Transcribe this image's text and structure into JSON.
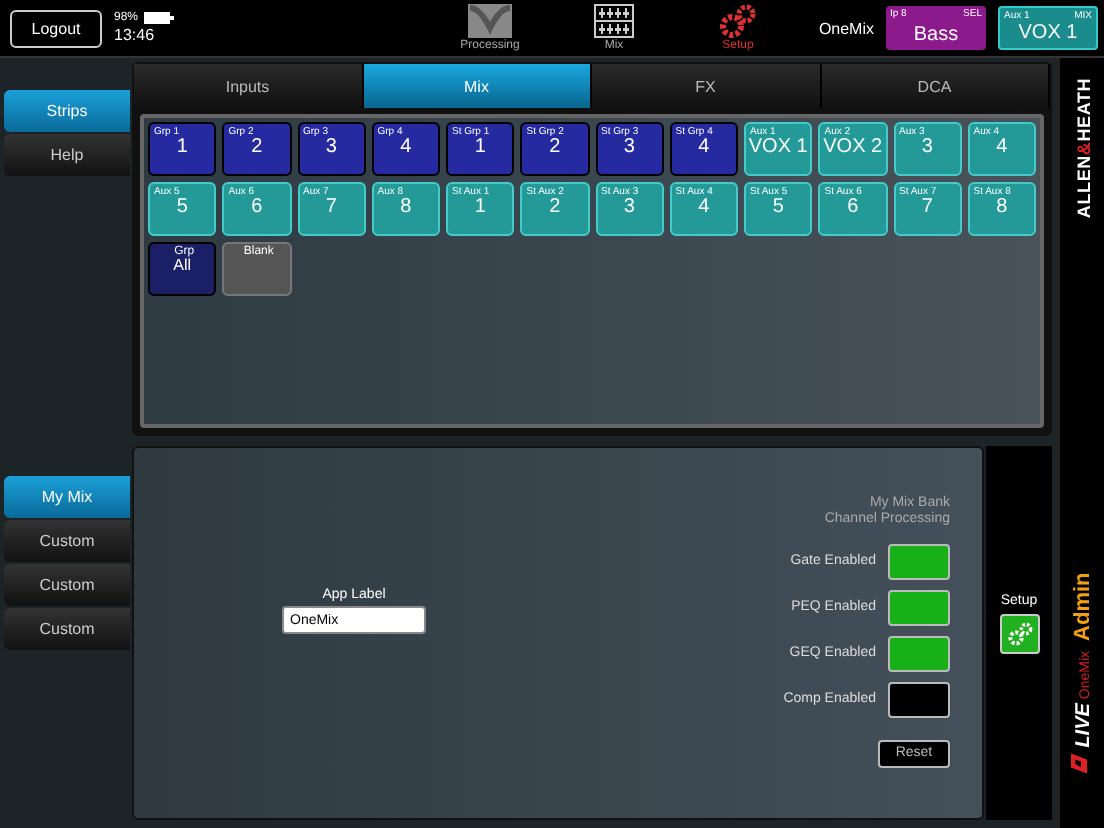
{
  "top_bar": {
    "logout": "Logout",
    "battery": "98%",
    "time": "13:46",
    "nav": [
      {
        "label": "Processing",
        "kind": "processing",
        "selected": false
      },
      {
        "label": "Mix",
        "kind": "mix",
        "selected": false
      },
      {
        "label": "Setup",
        "kind": "setup",
        "selected": true
      }
    ],
    "mix_name": "OneMix",
    "strips": [
      {
        "tag": "Ip 8",
        "mode": "SEL",
        "name": "Bass",
        "kind": "input"
      },
      {
        "tag": "Aux 1",
        "mode": "MIX",
        "name": "VOX 1",
        "kind": "aux"
      }
    ]
  },
  "left_menu": [
    {
      "label": "Strips",
      "selected": true
    },
    {
      "label": "Help",
      "selected": false
    }
  ],
  "tabs": [
    {
      "label": "Inputs",
      "selected": false
    },
    {
      "label": "Mix",
      "selected": true
    },
    {
      "label": "FX",
      "selected": false
    },
    {
      "label": "DCA",
      "selected": false
    }
  ],
  "tiles": [
    {
      "tag": "Grp 1",
      "name": "1",
      "kind": "group"
    },
    {
      "tag": "Grp 2",
      "name": "2",
      "kind": "group"
    },
    {
      "tag": "Grp 3",
      "name": "3",
      "kind": "group"
    },
    {
      "tag": "Grp 4",
      "name": "4",
      "kind": "group"
    },
    {
      "tag": "St Grp 1",
      "name": "1",
      "kind": "group"
    },
    {
      "tag": "St Grp 2",
      "name": "2",
      "kind": "group"
    },
    {
      "tag": "St Grp 3",
      "name": "3",
      "kind": "group"
    },
    {
      "tag": "St Grp 4",
      "name": "4",
      "kind": "group"
    },
    {
      "tag": "Aux 1",
      "name": "VOX 1",
      "kind": "aux"
    },
    {
      "tag": "Aux 2",
      "name": "VOX 2",
      "kind": "aux"
    },
    {
      "tag": "Aux 3",
      "name": "3",
      "kind": "aux"
    },
    {
      "tag": "Aux 4",
      "name": "4",
      "kind": "aux"
    },
    {
      "tag": "Aux 5",
      "name": "5",
      "kind": "aux"
    },
    {
      "tag": "Aux 6",
      "name": "6",
      "kind": "aux"
    },
    {
      "tag": "Aux 7",
      "name": "7",
      "kind": "aux"
    },
    {
      "tag": "Aux 8",
      "name": "8",
      "kind": "aux"
    },
    {
      "tag": "St Aux 1",
      "name": "1",
      "kind": "aux"
    },
    {
      "tag": "St Aux 2",
      "name": "2",
      "kind": "aux"
    },
    {
      "tag": "St Aux 3",
      "name": "3",
      "kind": "aux"
    },
    {
      "tag": "St Aux 4",
      "name": "4",
      "kind": "aux"
    },
    {
      "tag": "St Aux 5",
      "name": "5",
      "kind": "aux"
    },
    {
      "tag": "St Aux 6",
      "name": "6",
      "kind": "aux"
    },
    {
      "tag": "St Aux 7",
      "name": "7",
      "kind": "aux"
    },
    {
      "tag": "St Aux 8",
      "name": "8",
      "kind": "aux"
    },
    {
      "tag": "Grp",
      "name": "All",
      "kind": "all"
    },
    {
      "tag": "Blank",
      "kind": "blank"
    }
  ],
  "mix_menu": [
    {
      "label": "My Mix",
      "selected": true
    },
    {
      "label": "Custom",
      "selected": false
    },
    {
      "label": "Custom",
      "selected": false
    },
    {
      "label": "Custom",
      "selected": false
    }
  ],
  "app_label": {
    "label": "App Label",
    "value": "OneMix"
  },
  "processing": {
    "title": "My Mix Bank",
    "subtitle": "Channel Processing",
    "options": [
      {
        "label": "Gate Enabled",
        "checked": true
      },
      {
        "label": "PEQ Enabled",
        "checked": true
      },
      {
        "label": "GEQ Enabled",
        "checked": true
      },
      {
        "label": "Comp Enabled",
        "checked": false
      }
    ],
    "reset": "Reset"
  },
  "setup": {
    "label": "Setup"
  },
  "brand": {
    "parts": [
      {
        "text": "ALLEN",
        "accent": false
      },
      {
        "text": "&",
        "accent": true
      },
      {
        "text": "HEATH",
        "accent": false
      }
    ],
    "product": "LIVE",
    "app": "OneMix",
    "role": "Admin"
  }
}
